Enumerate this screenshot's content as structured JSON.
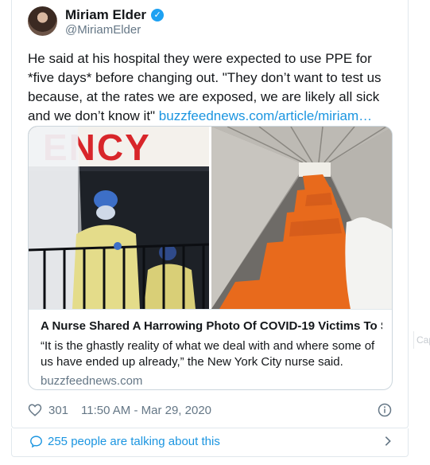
{
  "author": {
    "name": "Miriam Elder",
    "handle": "@MiriamElder",
    "verified": true
  },
  "tweet": {
    "text": "He said at his hospital they were expected to use PPE for *five days* before changing out. \"They don’t want to test us because, at the rates we are exposed, we are likely all sick and we don’t know it\" ",
    "link_text": "buzzfeednews.com/article/miriam…"
  },
  "card": {
    "image_left_sign_text": "ENCY",
    "title": "A Nurse Shared A Harrowing Photo Of COVID-19 Victims To S...",
    "description": "“It is the ghastly reality of what we deal with and where some of us have ended up already,” the New York City nurse said.",
    "domain": "buzzfeednews.com"
  },
  "meta": {
    "likes": "301",
    "timestamp": "11:50 AM - Mar 29, 2020"
  },
  "talking": {
    "label": "255 people are talking about this"
  },
  "side_label": "Cap",
  "colors": {
    "link": "#1b95e0",
    "muted": "#657786",
    "border": "#e1e8ed",
    "bag_orange": "#e86a1c",
    "sign_red": "#d8262a"
  },
  "icons": [
    "verified-badge-icon",
    "heart-icon",
    "info-icon",
    "speech-bubble-icon",
    "chevron-right-icon"
  ]
}
